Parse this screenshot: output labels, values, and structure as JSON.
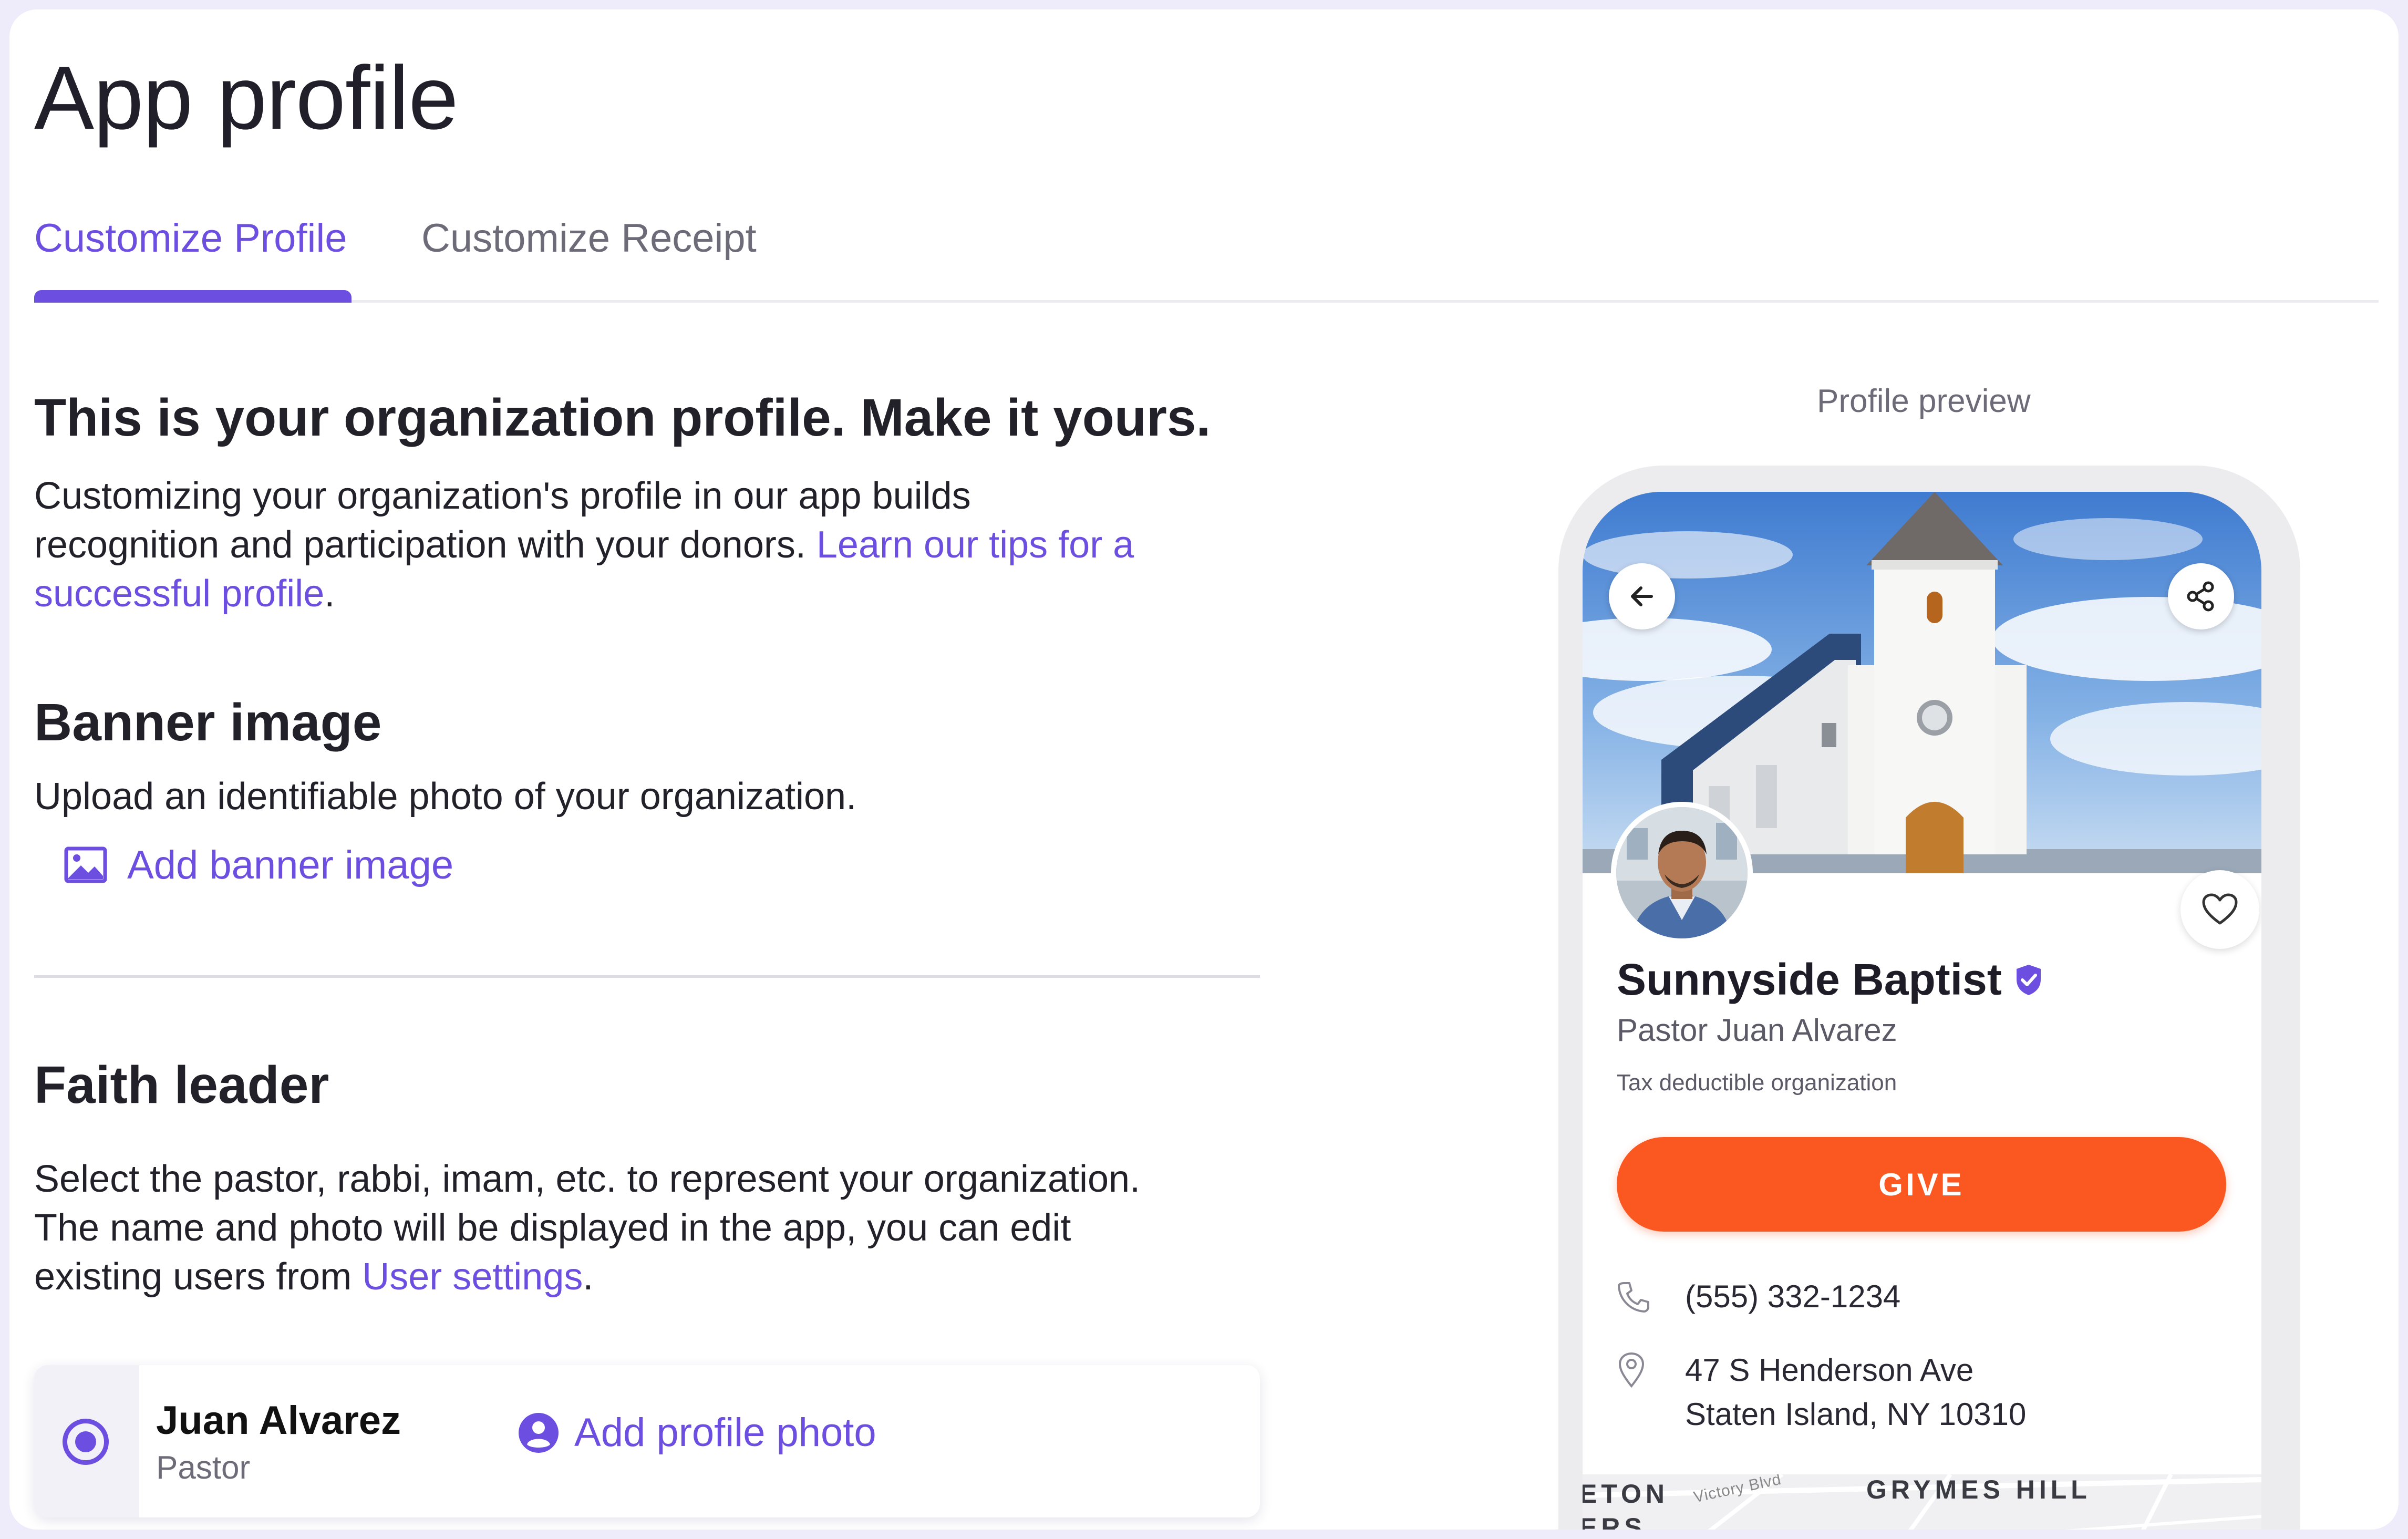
{
  "page": {
    "title": "App profile"
  },
  "tabs": [
    {
      "label": "Customize Profile",
      "active": true
    },
    {
      "label": "Customize Receipt",
      "active": false
    }
  ],
  "intro": {
    "heading": "This is your organization profile. Make it yours.",
    "line1": "Customizing your organization's profile in our app builds",
    "line2_text": "recognition and participation with your donors. ",
    "link_part1": "Learn our tips for a",
    "link_part2": "successful profile",
    "line3_suffix": "."
  },
  "banner": {
    "heading": "Banner image",
    "description": "Upload an identifiable photo of your organization.",
    "add_label": "Add banner image",
    "icon": "image-icon"
  },
  "faith_leader": {
    "heading": "Faith leader",
    "line1": "Select the pastor, rabbi, imam, etc. to represent your organization.",
    "line2": "The name and photo will be displayed in the app, you can edit",
    "line3_prefix": "existing users from ",
    "link": "User settings",
    "line3_suffix": ".",
    "leader": {
      "name": "Juan Alvarez",
      "role": "Pastor",
      "selected": true,
      "add_photo_label": "Add profile photo",
      "icon": "user-circle-icon"
    }
  },
  "preview": {
    "label": "Profile preview",
    "org_name": "Sunnyside Baptist",
    "leader_line": "Pastor Juan Alvarez",
    "tax_status": "Tax deductible organization",
    "give_label": "GIVE",
    "phone": "(555) 332-1234",
    "address_line1": "47 S Henderson Ave",
    "address_line2": "Staten Island, NY 10310",
    "map_labels": {
      "left_top": "ETON",
      "left_bottom": "ERS",
      "street": "Victory Blvd",
      "neighborhood": "GRYMES HILL"
    }
  },
  "colors": {
    "accent": "#6c4fe0",
    "give": "#fb5720",
    "verified": "#6c4fe0"
  }
}
